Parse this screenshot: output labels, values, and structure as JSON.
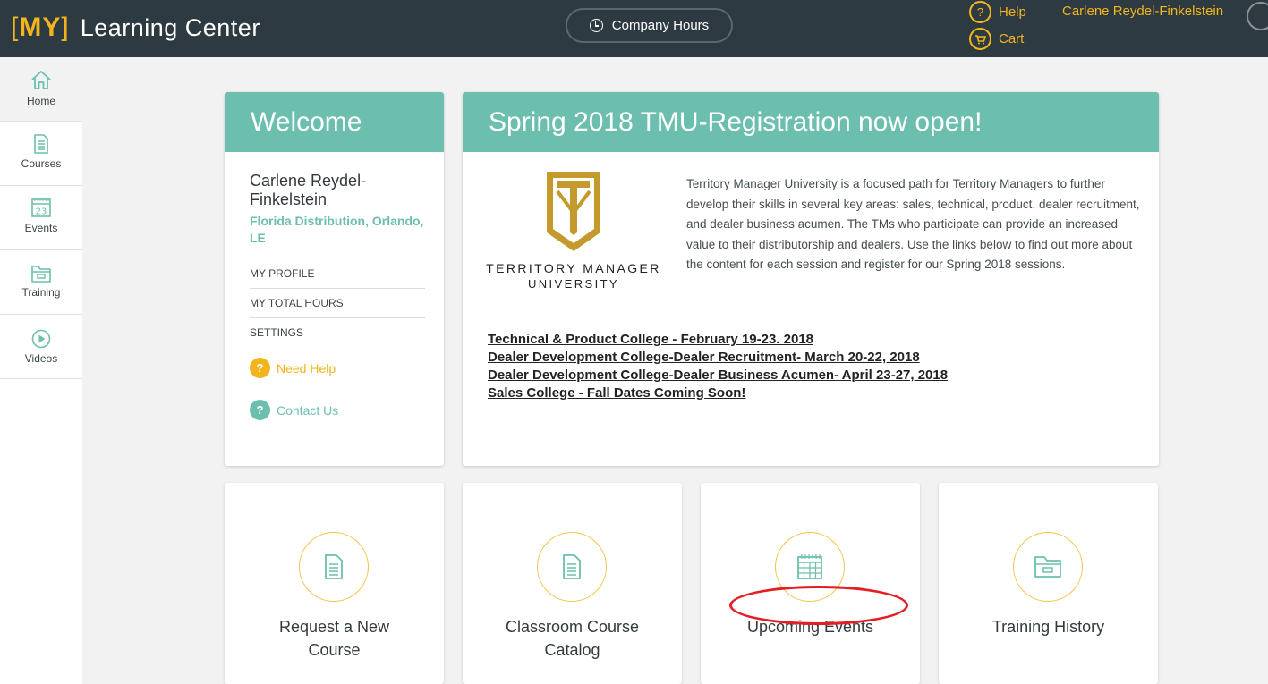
{
  "header": {
    "brand_box": "MY",
    "brand_title": "Learning Center",
    "company_hours": "Company Hours",
    "help": "Help",
    "cart": "Cart",
    "user_name": "Carlene Reydel-Finkelstein",
    "help_glyph": "?",
    "colors": {
      "bar": "#2e3a42",
      "accent": "#f2b51c"
    }
  },
  "sidebar": {
    "items": [
      {
        "label": "Home",
        "icon": "home-icon"
      },
      {
        "label": "Courses",
        "icon": "document-icon"
      },
      {
        "label": "Events",
        "icon": "calendar-icon",
        "day": "23"
      },
      {
        "label": "Training",
        "icon": "folder-icon"
      },
      {
        "label": "Videos",
        "icon": "play-icon"
      }
    ]
  },
  "welcome": {
    "title": "Welcome",
    "name": "Carlene Reydel-Finkelstein",
    "location": "Florida Distribution, Orlando, LE",
    "links": [
      "MY PROFILE",
      "MY TOTAL HOURS",
      "SETTINGS"
    ],
    "need_help": "Need Help",
    "contact_us": "Contact Us",
    "glyph": "?"
  },
  "promo": {
    "title": "Spring 2018 TMU-Registration now open!",
    "logo_line1": "TERRITORY MANAGER",
    "logo_line2": "UNIVERSITY",
    "description": "Territory Manager University is a focused path for Territory Managers to further develop their skills in several key areas: sales, technical, product, dealer recruitment, and dealer business acumen. The TMs who participate can provide an increased value to their distributorship and dealers. Use the links below to find out more about the content for each session and register for our Spring 2018 sessions.",
    "links": [
      "Technical & Product College - February 19-23. 2018",
      "Dealer Development College-Dealer Recruitment- March 20-22, 2018",
      "Dealer Development College-Dealer Business Acumen- April 23-27, 2018",
      "Sales College  - Fall Dates Coming Soon!"
    ]
  },
  "tiles": [
    {
      "label": "Request a New Course",
      "icon": "document-icon"
    },
    {
      "label": "Classroom Course Catalog",
      "icon": "document-icon"
    },
    {
      "label": "Upcoming Events",
      "icon": "calendar-icon"
    },
    {
      "label": "Training History",
      "icon": "folder-icon"
    }
  ],
  "colors": {
    "teal": "#6cbfae",
    "gold": "#f2b51c",
    "annotation_red": "#e31e24"
  }
}
